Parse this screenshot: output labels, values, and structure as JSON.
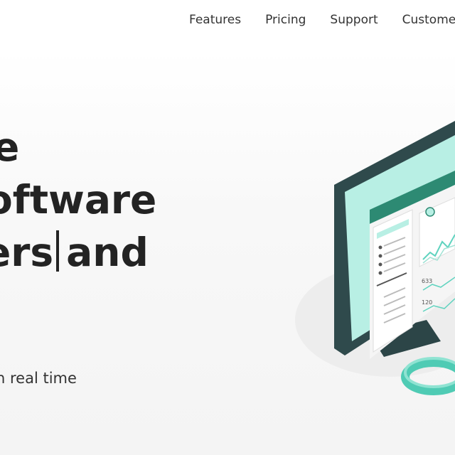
{
  "nav": {
    "items": [
      "Features",
      "Pricing",
      "Support",
      "Customers"
    ]
  },
  "hero": {
    "line1": "e",
    "line2": "oftware",
    "line3_word": "ers",
    "line3_rest": "and",
    "subtitle": "n real time"
  },
  "illustration": {
    "metric_1": "633",
    "metric_2": "120"
  },
  "colors": {
    "accent": "#5fd3bf",
    "accent_light": "#b8efe4",
    "monitor": "#2f4a4c",
    "highlight": "#c9e2a8"
  }
}
